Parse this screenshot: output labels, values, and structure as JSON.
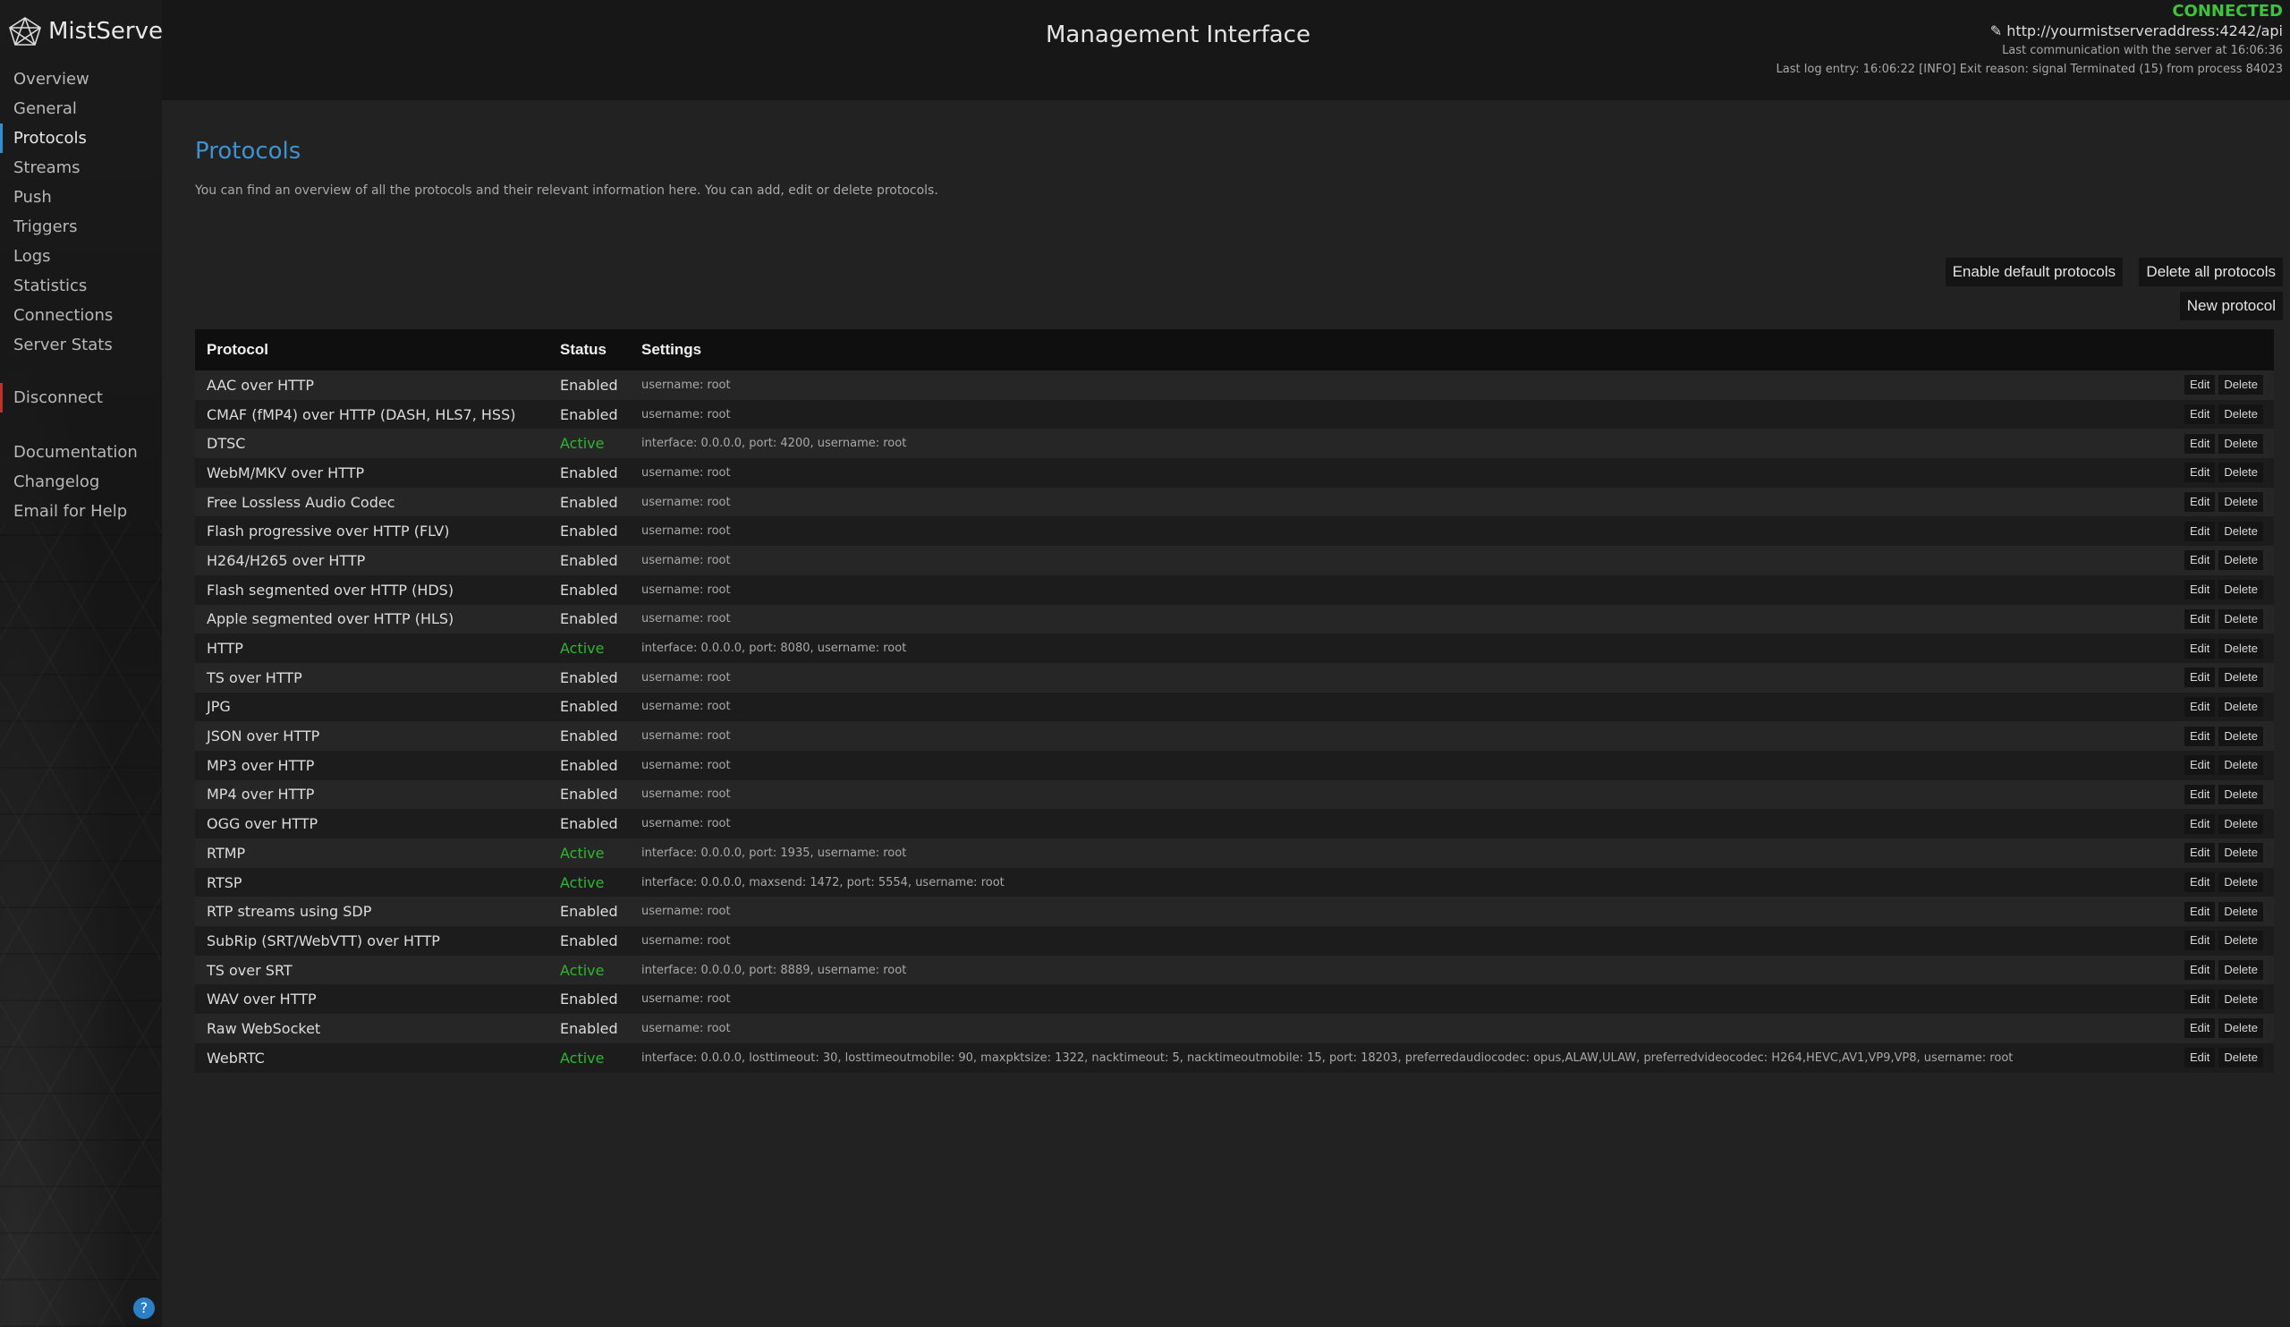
{
  "app": {
    "name": "MistServer",
    "header_title": "Management Interface"
  },
  "connection": {
    "status": "CONNECTED",
    "api_url": "http://yourmistserveraddress:4242/api",
    "last_comm": "Last communication with the server at 16:06:36",
    "last_log": "Last log entry: 16:06:22 [INFO] Exit reason: signal Terminated (15) from process 84023",
    "status_color": "#3cc43c"
  },
  "sidebar": {
    "items": [
      {
        "label": "Overview"
      },
      {
        "label": "General"
      },
      {
        "label": "Protocols"
      },
      {
        "label": "Streams"
      },
      {
        "label": "Push"
      },
      {
        "label": "Triggers"
      },
      {
        "label": "Logs"
      },
      {
        "label": "Statistics"
      },
      {
        "label": "Connections"
      },
      {
        "label": "Server Stats"
      }
    ],
    "disconnect": "Disconnect",
    "links": [
      {
        "label": "Documentation"
      },
      {
        "label": "Changelog"
      },
      {
        "label": "Email for Help"
      }
    ],
    "help": "?",
    "active": "Protocols"
  },
  "page": {
    "title": "Protocols",
    "description": "You can find an overview of all the protocols and their relevant information here. You can add, edit or delete protocols.",
    "buttons": {
      "enable_default": "Enable default protocols",
      "delete_all": "Delete all protocols",
      "new": "New protocol"
    }
  },
  "table": {
    "headers": {
      "protocol": "Protocol",
      "status": "Status",
      "settings": "Settings"
    },
    "edit_label": "Edit",
    "delete_label": "Delete",
    "rows": [
      {
        "protocol": "AAC over HTTP",
        "status": "Enabled",
        "settings": "username: root"
      },
      {
        "protocol": "CMAF (fMP4) over HTTP (DASH, HLS7, HSS)",
        "status": "Enabled",
        "settings": "username: root"
      },
      {
        "protocol": "DTSC",
        "status": "Active",
        "settings": "interface: 0.0.0.0, port: 4200, username: root"
      },
      {
        "protocol": "WebM/MKV over HTTP",
        "status": "Enabled",
        "settings": "username: root"
      },
      {
        "protocol": "Free Lossless Audio Codec",
        "status": "Enabled",
        "settings": "username: root"
      },
      {
        "protocol": "Flash progressive over HTTP (FLV)",
        "status": "Enabled",
        "settings": "username: root"
      },
      {
        "protocol": "H264/H265 over HTTP",
        "status": "Enabled",
        "settings": "username: root"
      },
      {
        "protocol": "Flash segmented over HTTP (HDS)",
        "status": "Enabled",
        "settings": "username: root"
      },
      {
        "protocol": "Apple segmented over HTTP (HLS)",
        "status": "Enabled",
        "settings": "username: root"
      },
      {
        "protocol": "HTTP",
        "status": "Active",
        "settings": "interface: 0.0.0.0, port: 8080, username: root"
      },
      {
        "protocol": "TS over HTTP",
        "status": "Enabled",
        "settings": "username: root"
      },
      {
        "protocol": "JPG",
        "status": "Enabled",
        "settings": "username: root"
      },
      {
        "protocol": "JSON over HTTP",
        "status": "Enabled",
        "settings": "username: root"
      },
      {
        "protocol": "MP3 over HTTP",
        "status": "Enabled",
        "settings": "username: root"
      },
      {
        "protocol": "MP4 over HTTP",
        "status": "Enabled",
        "settings": "username: root"
      },
      {
        "protocol": "OGG over HTTP",
        "status": "Enabled",
        "settings": "username: root"
      },
      {
        "protocol": "RTMP",
        "status": "Active",
        "settings": "interface: 0.0.0.0, port: 1935, username: root"
      },
      {
        "protocol": "RTSP",
        "status": "Active",
        "settings": "interface: 0.0.0.0, maxsend: 1472, port: 5554, username: root"
      },
      {
        "protocol": "RTP streams using SDP",
        "status": "Enabled",
        "settings": "username: root"
      },
      {
        "protocol": "SubRip (SRT/WebVTT) over HTTP",
        "status": "Enabled",
        "settings": "username: root"
      },
      {
        "protocol": "TS over SRT",
        "status": "Active",
        "settings": "interface: 0.0.0.0, port: 8889, username: root"
      },
      {
        "protocol": "WAV over HTTP",
        "status": "Enabled",
        "settings": "username: root"
      },
      {
        "protocol": "Raw WebSocket",
        "status": "Enabled",
        "settings": "username: root"
      },
      {
        "protocol": "WebRTC",
        "status": "Active",
        "settings": "interface: 0.0.0.0, losttimeout: 30, losttimeoutmobile: 90, maxpktsize: 1322, nacktimeout: 5, nacktimeoutmobile: 15, port: 18203, preferredaudiocodec: opus,ALAW,ULAW, preferredvideocodec: H264,HEVC,AV1,VP9,VP8, username: root"
      }
    ]
  },
  "colors": {
    "accent": "#3c93cf",
    "active_status": "#2fb52f",
    "disconnect": "#c0302a"
  }
}
